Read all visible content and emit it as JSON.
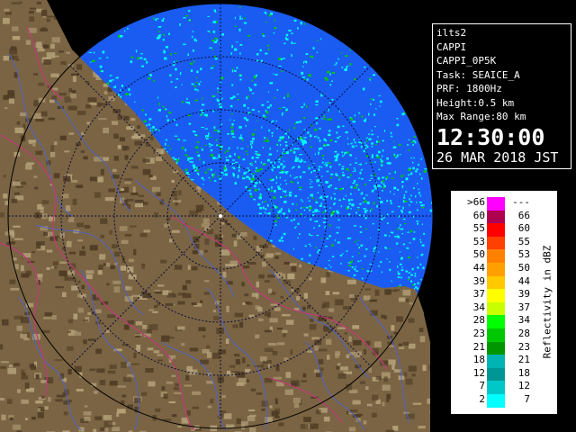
{
  "info": {
    "site": "ilts2",
    "product": "CAPPI",
    "product_sub": "CAPPI_0P5K",
    "task": "Task: SEAICE_A",
    "prf": "PRF: 1800Hz",
    "height": "Height:0.5 km",
    "max_range": "Max Range:80 km",
    "time": "12:30:00",
    "date": "26 MAR 2018 JST"
  },
  "legend": {
    "title": "Reflectivity in dBZ",
    "rows": [
      {
        "lo": ">66",
        "hi": "---",
        "color": "#ff00ff"
      },
      {
        "lo": "60",
        "hi": "66",
        "color": "#b00050"
      },
      {
        "lo": "55",
        "hi": "60",
        "color": "#ff0000"
      },
      {
        "lo": "53",
        "hi": "55",
        "color": "#ff4000"
      },
      {
        "lo": "50",
        "hi": "53",
        "color": "#ff8000"
      },
      {
        "lo": "44",
        "hi": "50",
        "color": "#ffa000"
      },
      {
        "lo": "39",
        "hi": "44",
        "color": "#ffc800"
      },
      {
        "lo": "37",
        "hi": "39",
        "color": "#ffff00"
      },
      {
        "lo": "34",
        "hi": "37",
        "color": "#c8ff00"
      },
      {
        "lo": "28",
        "hi": "34",
        "color": "#00ff00"
      },
      {
        "lo": "23",
        "hi": "28",
        "color": "#00c800"
      },
      {
        "lo": "21",
        "hi": "23",
        "color": "#009600"
      },
      {
        "lo": "18",
        "hi": "21",
        "color": "#00b4b4"
      },
      {
        "lo": "12",
        "hi": "18",
        "color": "#009696"
      },
      {
        "lo": "7",
        "hi": "12",
        "color": "#00c8c8"
      },
      {
        "lo": "2",
        "hi": "7",
        "color": "#00ffff"
      }
    ]
  },
  "colors": {
    "sea": "#1a5cf2",
    "land": "#7a6443",
    "land_dark": "#4e3b24",
    "land_light": "#b5a27a",
    "rivers": "#4f63c8",
    "borders": "#c03a7a",
    "echo_cyan": "#00ffff",
    "echo_green": "#00c800"
  }
}
